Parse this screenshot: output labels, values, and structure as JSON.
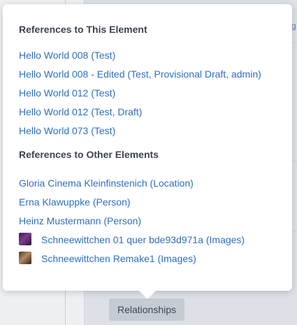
{
  "background": {
    "side_char": "g"
  },
  "popover": {
    "section_this": {
      "title": "References to This Element",
      "items": [
        {
          "label": "Hello World 008 (Test)"
        },
        {
          "label": "Hello World 008 - Edited (Test, Provisional Draft, admin)"
        },
        {
          "label": "Hello World 012 (Test)"
        },
        {
          "label": "Hello World 012 (Test, Draft)"
        },
        {
          "label": "Hello World 073 (Test)"
        }
      ]
    },
    "section_other": {
      "title": "References to Other Elements",
      "items": [
        {
          "label": "Gloria Cinema Kleinfinstenich (Location)"
        },
        {
          "label": "Erna Klawuppke (Person)"
        },
        {
          "label": "Heinz Mustermann (Person)"
        },
        {
          "label": "Schneewittchen 01 quer bde93d971a (Images)",
          "icon": "image-thumbnail-icon"
        },
        {
          "label": "Schneewittchen Remake1 (Images)",
          "icon": "image-thumbnail-icon"
        }
      ]
    }
  },
  "button": {
    "label": "Relationships"
  },
  "colors": {
    "link": "#2f6fc0",
    "heading": "#3a4450",
    "button_bg": "#c5cbd3"
  }
}
